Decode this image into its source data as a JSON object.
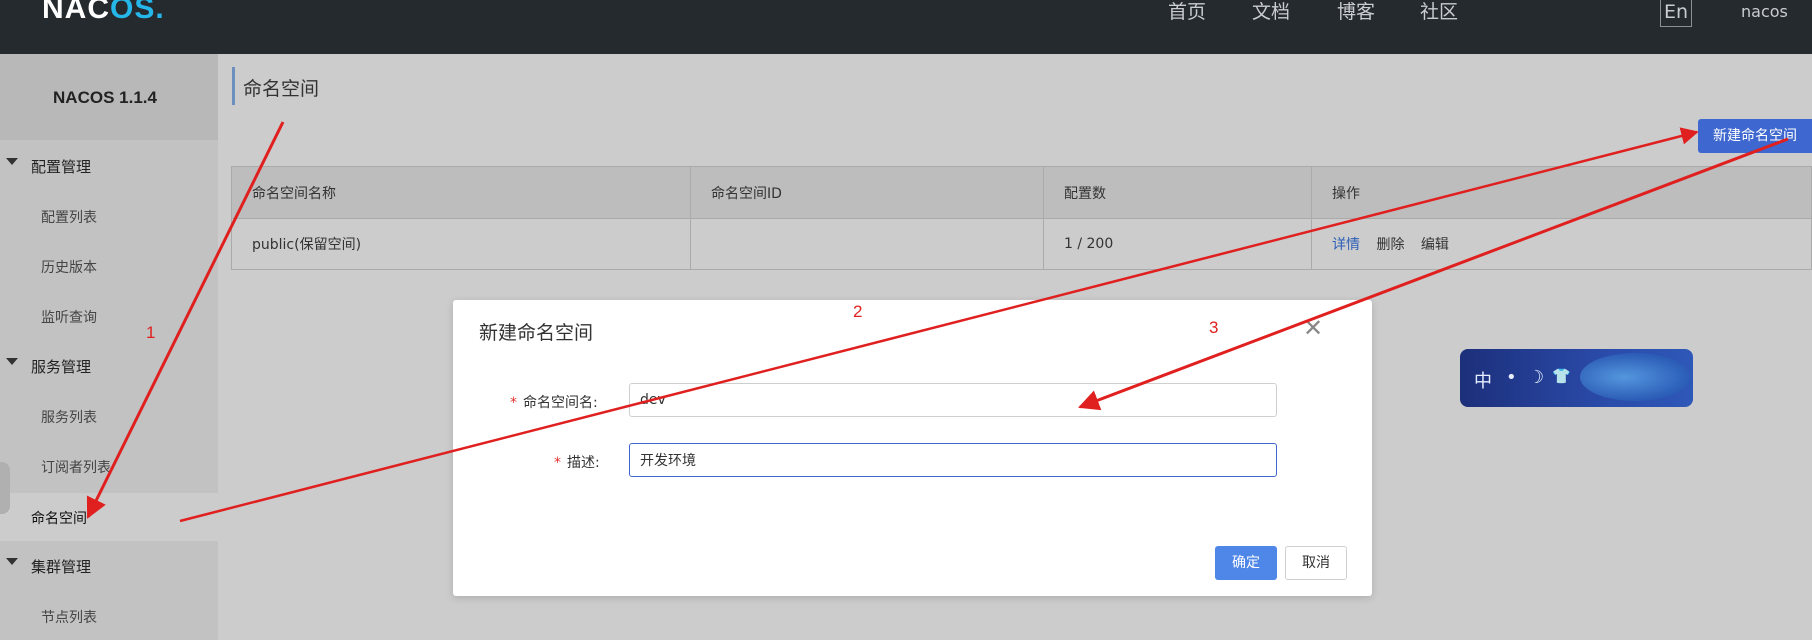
{
  "topbar": {
    "logo_main": "NAC",
    "logo_accent": "OS",
    "logo_suffix": ".",
    "nav": [
      "首页",
      "文档",
      "博客",
      "社区"
    ],
    "lang": "En",
    "user": "nacos"
  },
  "sidebar": {
    "title": "NACOS 1.1.4",
    "groups": [
      {
        "label": "配置管理",
        "items": [
          "配置列表",
          "历史版本",
          "监听查询"
        ]
      },
      {
        "label": "服务管理",
        "items": [
          "服务列表",
          "订阅者列表",
          "命名空间"
        ]
      },
      {
        "label": "集群管理",
        "items": [
          "节点列表"
        ]
      }
    ],
    "active_item": "命名空间"
  },
  "main": {
    "page_title": "命名空间",
    "new_button": "新建命名空间",
    "table": {
      "headers": [
        "命名空间名称",
        "命名空间ID",
        "配置数",
        "操作"
      ],
      "rows": [
        {
          "name": "public(保留空间)",
          "id": "",
          "count": "1 / 200",
          "ops": [
            "详情",
            "删除",
            "编辑"
          ]
        }
      ]
    }
  },
  "badge": {
    "glyphs": [
      "中",
      "•",
      "☽",
      "👕"
    ]
  },
  "dialog": {
    "title": "新建命名空间",
    "close_icon": "close-icon",
    "fields": [
      {
        "label": "命名空间名:",
        "value": "dev"
      },
      {
        "label": "描述:",
        "value": "开发环境"
      }
    ],
    "ok": "确定",
    "cancel": "取消"
  },
  "annotations": {
    "labels": [
      "1",
      "2",
      "3"
    ],
    "color": "#e01f1f"
  },
  "colors": {
    "topbar": "#252a2f",
    "primary": "#3e67cf",
    "link": "#2d5fb8",
    "required": "#e0322e"
  }
}
